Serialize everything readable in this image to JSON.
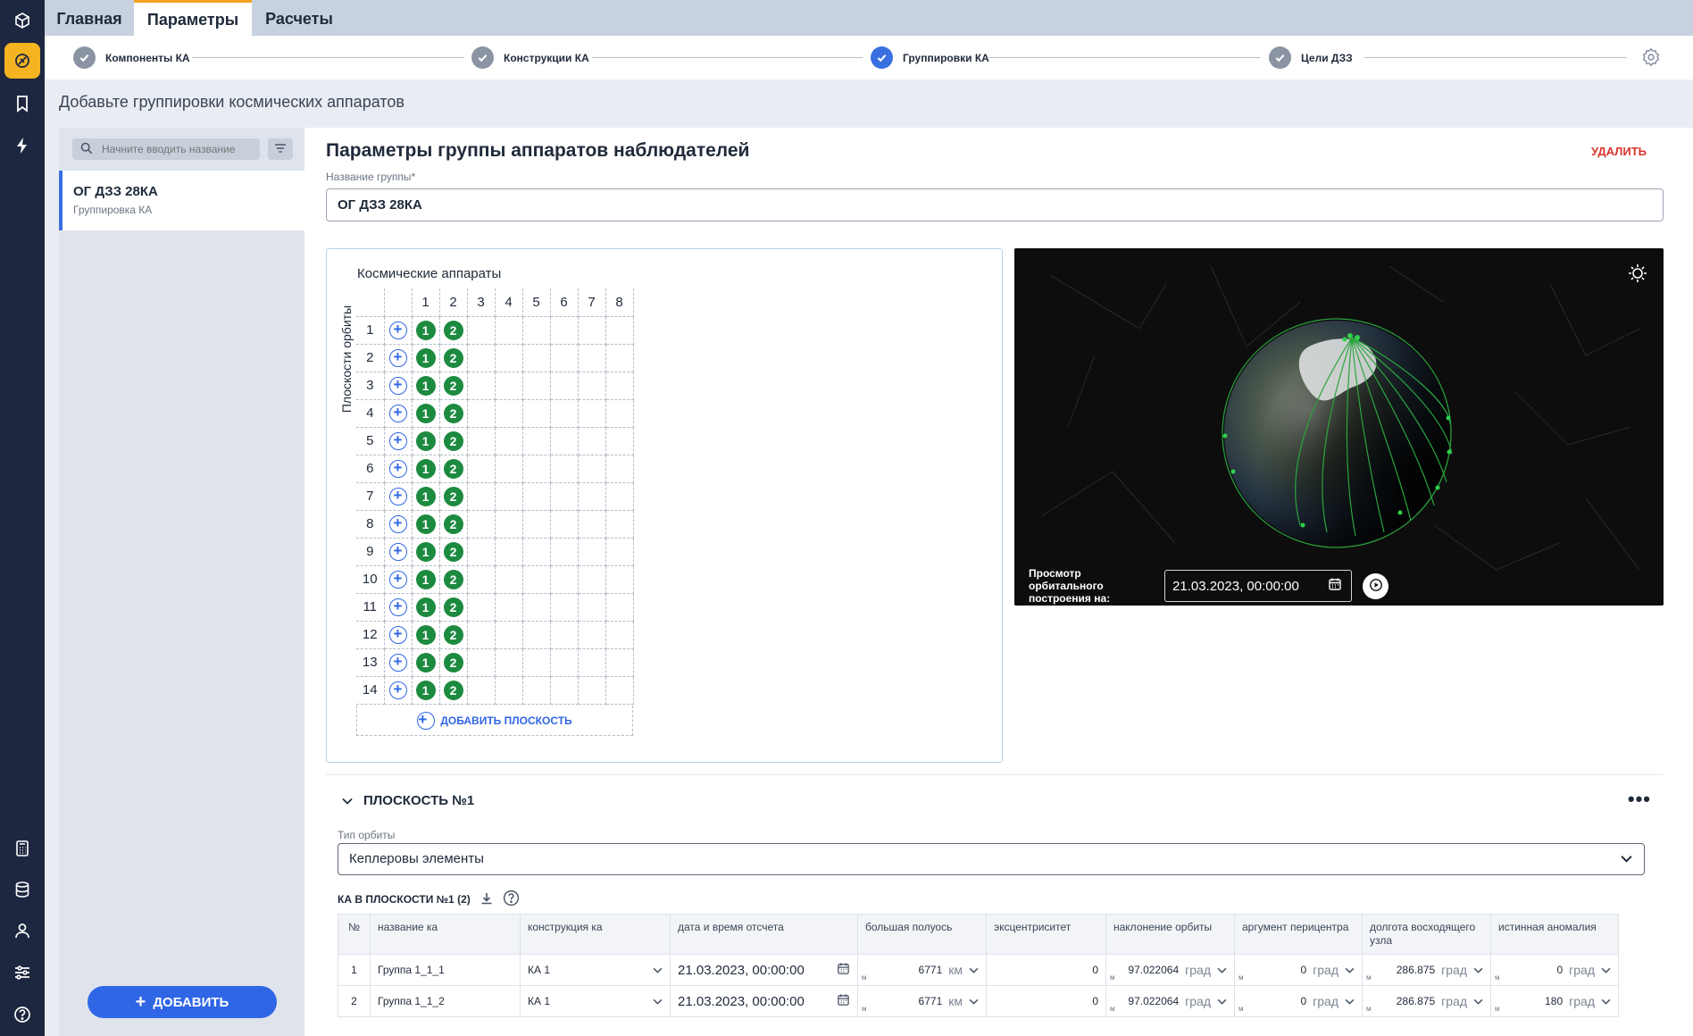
{
  "rail": {
    "items": [
      "cube-icon",
      "satellite-icon",
      "bookmark-icon",
      "bolt-icon",
      "calculator-icon",
      "database-icon",
      "user-icon",
      "sliders-icon",
      "help-icon"
    ]
  },
  "tabs": [
    {
      "label": "Главная",
      "active": false
    },
    {
      "label": "Параметры",
      "active": true
    },
    {
      "label": "Расчеты",
      "active": false
    }
  ],
  "steps": [
    {
      "label": "Компоненты КА",
      "state": "done"
    },
    {
      "label": "Конструкции КА",
      "state": "done"
    },
    {
      "label": "Группировки КА",
      "state": "current"
    },
    {
      "label": "Цели ДЗЗ",
      "state": "done"
    }
  ],
  "page": {
    "subtitle": "Добавьте группировки космических аппаратов"
  },
  "list": {
    "search_placeholder": "Начните вводить название",
    "items": [
      {
        "title": "ОГ ДЗЗ 28КА",
        "subtitle": "Группировка КА"
      }
    ],
    "add_label": "ДОБАВИТЬ"
  },
  "form": {
    "title": "Параметры группы аппаратов наблюдателей",
    "delete_label": "УДАЛИТЬ",
    "name_label": "Название группы*",
    "name_value": "ОГ ДЗЗ 28КА"
  },
  "grid": {
    "title": "Космические аппараты",
    "axis_label": "Плоскости орбиты",
    "columns": [
      "1",
      "2",
      "3",
      "4",
      "5",
      "6",
      "7",
      "8"
    ],
    "rows": [
      "1",
      "2",
      "3",
      "4",
      "5",
      "6",
      "7",
      "8",
      "9",
      "10",
      "11",
      "12",
      "13",
      "14"
    ],
    "sats_per_row": [
      "1",
      "2"
    ],
    "add_plane_label": "ДОБАВИТЬ ПЛОСКОСТЬ"
  },
  "viewer": {
    "caption": "Просмотр орбитального построения на:",
    "datetime": "21.03.2023, 00:00:00"
  },
  "plane": {
    "title": "ПЛОСКОСТЬ №1",
    "orbit_type_label": "Тип орбиты",
    "orbit_type_value": "Кеплеровы элементы",
    "ka_header": "КА В ПЛОСКОСТИ №1 (2)",
    "columns": [
      "№",
      "название ка",
      "конструкция ка",
      "дата и время отсчета",
      "большая полуось",
      "эксцентриситет",
      "наклонение орбиты",
      "аргумент перицентра",
      "долгота восходящего узла",
      "истинная аномалия"
    ],
    "rows": [
      {
        "n": "1",
        "name": "Группа 1_1_1",
        "construct": "КА 1",
        "datetime": "21.03.2023, 00:00:00",
        "axis": "6771",
        "axis_unit": "км",
        "ecc": "0",
        "incl": "97.022064",
        "incl_unit": "град",
        "argp": "0",
        "argp_unit": "град",
        "raan": "286.875",
        "raan_unit": "град",
        "anom": "0",
        "anom_unit": "град"
      },
      {
        "n": "2",
        "name": "Группа 1_1_2",
        "construct": "КА 1",
        "datetime": "21.03.2023, 00:00:00",
        "axis": "6771",
        "axis_unit": "км",
        "ecc": "0",
        "incl": "97.022064",
        "incl_unit": "град",
        "argp": "0",
        "argp_unit": "град",
        "raan": "286.875",
        "raan_unit": "град",
        "anom": "180",
        "anom_unit": "град"
      }
    ]
  },
  "colors": {
    "accent": "#2f66e6",
    "active_tab": "#f4a020",
    "sat": "#1c8a3f",
    "delete": "#d9342b",
    "rail": "#1d2740"
  }
}
